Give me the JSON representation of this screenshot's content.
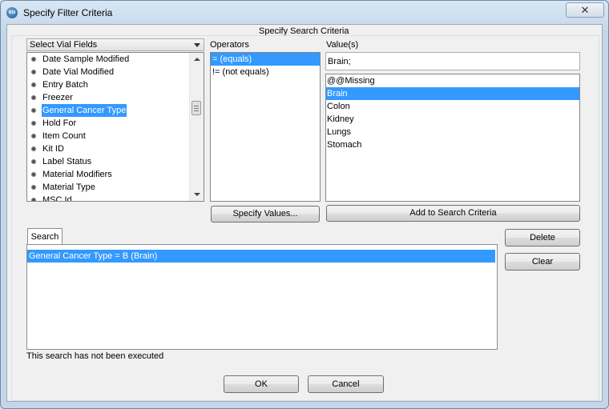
{
  "window": {
    "title": "Specify Filter Criteria",
    "icon": "app-logo-icon",
    "app_icon_text": "BSI",
    "close_glyph": "✕"
  },
  "section_title": "Specify Search Criteria",
  "fields": {
    "combo_label": "Select Vial Fields",
    "items": [
      {
        "label": "Date Sample Modified",
        "selected": false
      },
      {
        "label": "Date Vial Modified",
        "selected": false
      },
      {
        "label": "Entry Batch",
        "selected": false
      },
      {
        "label": "Freezer",
        "selected": false
      },
      {
        "label": "General Cancer Type",
        "selected": true
      },
      {
        "label": "Hold For",
        "selected": false
      },
      {
        "label": "Item Count",
        "selected": false
      },
      {
        "label": "Kit ID",
        "selected": false
      },
      {
        "label": "Label Status",
        "selected": false
      },
      {
        "label": "Material Modifiers",
        "selected": false
      },
      {
        "label": "Material Type",
        "selected": false
      },
      {
        "label": "MSC Id",
        "selected": false
      }
    ]
  },
  "operators": {
    "label": "Operators",
    "items": [
      {
        "label": "= (equals)",
        "selected": true
      },
      {
        "label": "!= (not equals)",
        "selected": false
      }
    ]
  },
  "values": {
    "label": "Value(s)",
    "input_value": "Brain;",
    "items": [
      {
        "label": "@@Missing",
        "selected": false
      },
      {
        "label": "Brain",
        "selected": true
      },
      {
        "label": "Colon",
        "selected": false
      },
      {
        "label": "Kidney",
        "selected": false
      },
      {
        "label": "Lungs",
        "selected": false
      },
      {
        "label": "Stomach",
        "selected": false
      }
    ]
  },
  "buttons": {
    "specify_values": "Specify Values...",
    "add_to_criteria": "Add to Search Criteria",
    "delete": "Delete",
    "clear": "Clear",
    "ok": "OK",
    "cancel": "Cancel"
  },
  "search": {
    "tab_label": "Search",
    "criteria": [
      {
        "label": "General Cancer Type = B (Brain)",
        "selected": true
      }
    ],
    "status": "This search has not been executed"
  },
  "colors": {
    "selection": "#3399ff",
    "window_frame": "#c4d7e9"
  }
}
